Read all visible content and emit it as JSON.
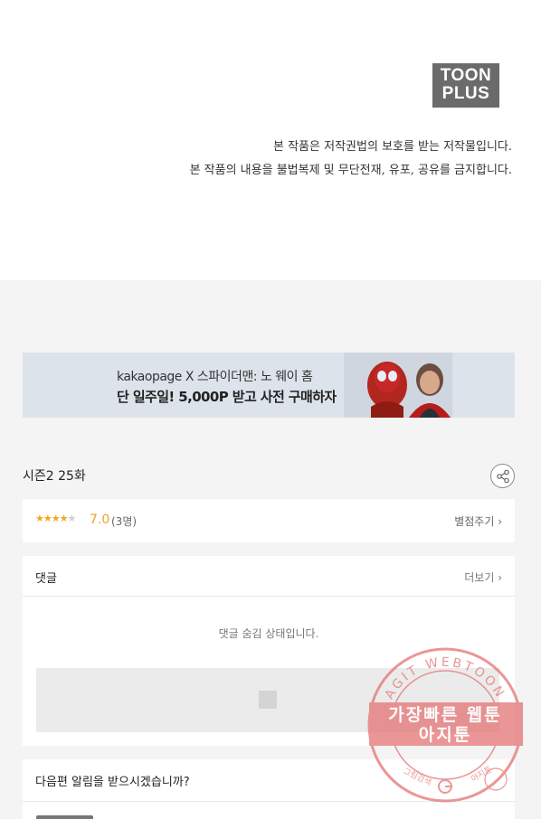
{
  "header": {
    "logo_line1": "TOON",
    "logo_line2": "PLUS",
    "copyright_line1": "본 작품은 저작권법의 보호를 받는 저작물입니다.",
    "copyright_line2": "본 작품의 내용을 불법복제 및 무단전재, 유포, 공유를 금지합니다."
  },
  "banner": {
    "line1": "kakaopage X 스파이더맨: 노 웨이 홈",
    "line2": "단 일주일! 5,000P 받고 사전 구매하자"
  },
  "episode": {
    "title": "시즌2 25화",
    "share_icon": "share-icon"
  },
  "rating": {
    "stars": 3.5,
    "score": "7.0",
    "count": "(3명)",
    "rate_link": "별점주기 ›",
    "color": "#f3a521"
  },
  "comments": {
    "label": "댓글",
    "more": "더보기 ›",
    "hidden_message": "댓글 숨김 상태입니다."
  },
  "notify": {
    "label": "다음편 알림을 받으시겠습니까?"
  },
  "watermark": {
    "ring_text": "AGIT WEBTOON",
    "line1": "가장빠른 웹툰",
    "line2": "아지툰",
    "bottom_left": "그림검색",
    "bottom_right": "아지툰",
    "color": "#e57373"
  }
}
